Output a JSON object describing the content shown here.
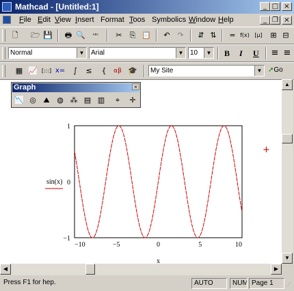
{
  "window": {
    "title": "Mathcad - [Untitled:1]",
    "minimize_glyph": "_",
    "maximize_glyph": "□",
    "close_glyph": "×"
  },
  "menubar": {
    "items": [
      {
        "key": "F",
        "rest": "ile"
      },
      {
        "key": "E",
        "rest": "dit"
      },
      {
        "key": "V",
        "rest": "iew"
      },
      {
        "key": "I",
        "rest": "nsert"
      },
      {
        "key": "",
        "rest": "Format"
      },
      {
        "key": "T",
        "rest": "oos"
      },
      {
        "key": "",
        "rest": "Symbolics"
      },
      {
        "key": "W",
        "rest": "indow"
      },
      {
        "key": "H",
        "rest": "elp"
      }
    ],
    "doc_min_glyph": "_",
    "doc_restore_glyph": "❐",
    "doc_close_glyph": "×"
  },
  "standard_toolbar": {
    "icons": [
      "new-document-icon",
      "open-folder-icon",
      "save-icon",
      "print-icon",
      "print-preview-icon",
      "spell-check-icon",
      "cut-icon",
      "copy-icon",
      "paste-icon",
      "undo-icon",
      "redo-icon",
      "align-across-icon",
      "align-down-icon",
      "calculate-icon",
      "insert-function-icon",
      "insert-unit-icon",
      "resources-icon",
      "zoom-icon"
    ],
    "glyphs": [
      "🗋",
      "🗁",
      "💾",
      "🖶",
      "🔍",
      "ᴬᴮᶜ",
      "✂",
      "⎘",
      "📋",
      "↶",
      "↷",
      "⇵",
      "⇅",
      "=",
      "f(x)",
      "[μ]",
      "⊞",
      "⊟"
    ]
  },
  "format_toolbar": {
    "style": "Normal",
    "font": "Arial",
    "size": "10",
    "bold": "B",
    "italic": "I",
    "underline": "U"
  },
  "math_toolbar": {
    "icons": [
      "calculator-icon",
      "graph-icon",
      "matrix-icon",
      "evaluation-icon",
      "calculus-icon",
      "boolean-icon",
      "programming-icon",
      "greek-icon",
      "symbolic-icon"
    ],
    "glyphs": [
      "▦",
      "📈",
      "[:::]",
      "x=",
      "∫",
      "≤",
      "{",
      "αβ",
      "🎓"
    ],
    "resource_combo": "My Site",
    "go_label": "Go"
  },
  "graph_palette": {
    "title": "Graph",
    "close_glyph": "×",
    "icons": [
      "xy-plot-icon",
      "polar-plot-icon",
      "surface-plot-icon",
      "contour-plot-icon",
      "3d-scatter-icon",
      "3d-bar-icon",
      "vector-field-icon",
      "zoom-icon",
      "trace-icon"
    ],
    "glyphs": [
      "📉",
      "◎",
      "⛰",
      "◍",
      "⁂",
      "▤",
      "▥",
      "⌖",
      "✛"
    ]
  },
  "chart_data": {
    "type": "line",
    "function": "sin(x)",
    "ylabel": "sin(x)",
    "xlabel": "x",
    "xlim": [
      -10,
      10
    ],
    "ylim": [
      -1,
      1
    ],
    "x_ticks": [
      "−10",
      "−5",
      "0",
      "5",
      "10"
    ],
    "y_ticks": [
      "1",
      "0",
      "−1"
    ],
    "series": [
      {
        "name": "sin(x)",
        "color": "#cc0000",
        "style": "dashed"
      }
    ]
  },
  "cursor_glyph": "+",
  "statusbar": {
    "help": "Press F1 for hep.",
    "mode": "AUTO",
    "num": "NUM",
    "page": "Page 1"
  },
  "colors": {
    "titlebar": "#0a246a",
    "trace": "#cc0000",
    "cursor": "#cc0000"
  }
}
